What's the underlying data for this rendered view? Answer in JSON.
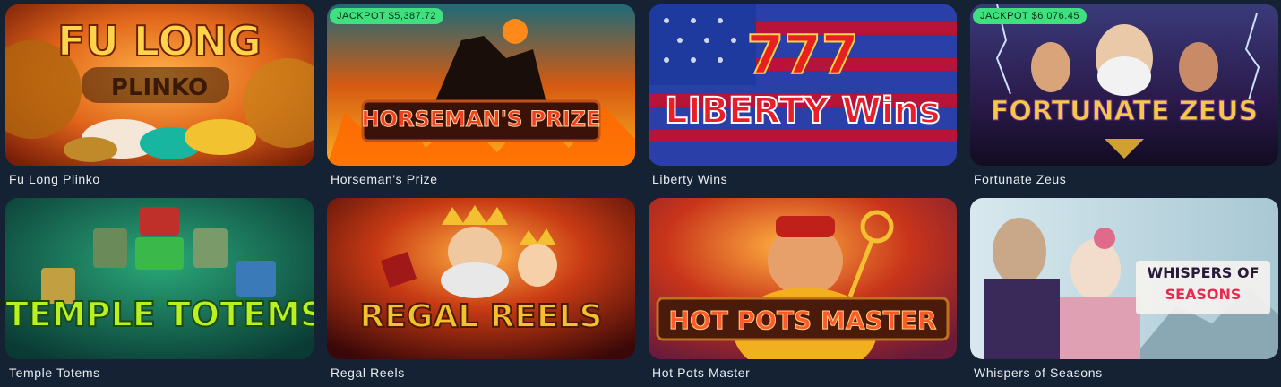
{
  "games": [
    {
      "title": "Fu Long Plinko",
      "logo_lines": [
        "FU LONG",
        "PLINKO"
      ],
      "jackpot": null
    },
    {
      "title": "Horseman's Prize",
      "logo_lines": [
        "HORSEMAN'S PRIZE"
      ],
      "jackpot": {
        "label": "JACKPOT",
        "amount": "$5,387.72"
      }
    },
    {
      "title": "Liberty Wins",
      "logo_lines": [
        "777",
        "LIBERTY Wins"
      ],
      "jackpot": null
    },
    {
      "title": "Fortunate Zeus",
      "logo_lines": [
        "FORTUNATE ZEUS"
      ],
      "jackpot": {
        "label": "JACKPOT",
        "amount": "$6,076.45"
      }
    },
    {
      "title": "Temple Totems",
      "logo_lines": [
        "TEMPLE TOTEMS"
      ],
      "jackpot": null
    },
    {
      "title": "Regal Reels",
      "logo_lines": [
        "REGAL REELS"
      ],
      "jackpot": null
    },
    {
      "title": "Hot Pots Master",
      "logo_lines": [
        "HOT POTS MASTER"
      ],
      "jackpot": null
    },
    {
      "title": "Whispers of Seasons",
      "logo_lines": [
        "WHISPERS OF",
        "SEASONS"
      ],
      "jackpot": null
    }
  ],
  "colors": {
    "page_background": "#152234",
    "jackpot_badge": "#3fe07e",
    "title_text": "#e8ecf2"
  }
}
